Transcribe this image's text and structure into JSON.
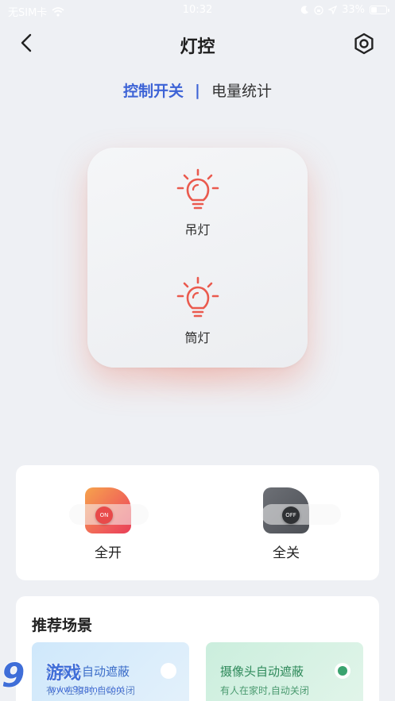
{
  "status_bar": {
    "carrier": "无SIM卡",
    "time": "10:32",
    "battery": "33%",
    "battery_level": 0.33
  },
  "nav": {
    "title": "灯控"
  },
  "tabs": {
    "active": "控制开关",
    "separator": "|",
    "inactive": "电量统计"
  },
  "lights": [
    {
      "label": "吊灯",
      "state": "on"
    },
    {
      "label": "筒灯",
      "state": "on"
    }
  ],
  "master_switches": {
    "all_on": {
      "label": "全开",
      "knob": "ON"
    },
    "all_off": {
      "label": "全关",
      "knob": "OFF"
    }
  },
  "scenes": {
    "title": "推荐场景",
    "items": [
      {
        "name": "摄像头自动遮蔽",
        "desc": "有人在家时,自动关闭",
        "selected": false
      },
      {
        "name": "摄像头自动遮蔽",
        "desc": "有人在家时,自动关闭",
        "selected": true
      }
    ]
  },
  "watermark": {
    "number": "9",
    "text": "游戏",
    "url": "www.9game.com"
  },
  "colors": {
    "accent_blue": "#3d63d6",
    "lamp_red": "#ea5a4e",
    "on_gradient_start": "#f6a34c",
    "on_gradient_end": "#e83f57",
    "off_tile": "#5b5e64",
    "scene_green": "#3aa36f"
  }
}
